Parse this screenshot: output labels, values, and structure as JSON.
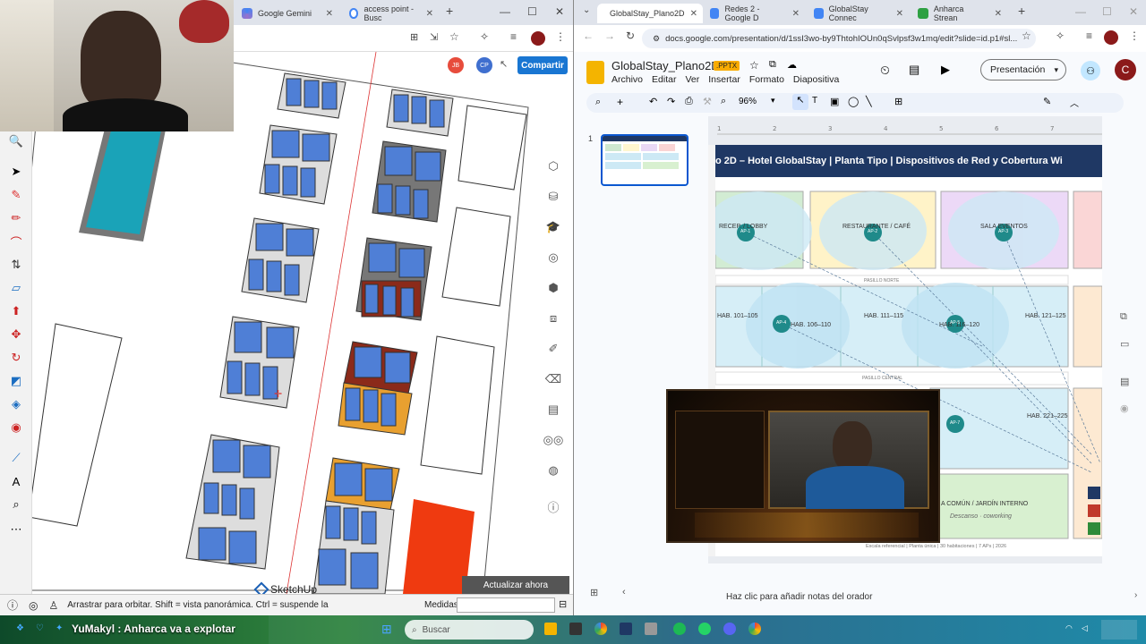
{
  "left_browser": {
    "tabs": [
      {
        "label": "Google Gemini"
      },
      {
        "label": "access point - Busc"
      }
    ],
    "share_button": "Compartir",
    "avatar_a": "JB",
    "avatar_b": "CP"
  },
  "sketchup": {
    "logo": "SketchUp",
    "update_button": "Actualizar ahora",
    "status_text": "Arrastrar para orbitar. Shift = vista panorámica. Ctrl = suspende la",
    "measures_label": "Medidas"
  },
  "right_browser": {
    "tabs": [
      {
        "label": "GlobalStay_Plano2D"
      },
      {
        "label": "Redes 2 - Google D"
      },
      {
        "label": "GlobalStay Connec"
      },
      {
        "label": "Anharca Strean"
      }
    ],
    "url": "docs.google.com/presentation/d/1ssI3wo-by9ThtohIOUn0qSvlpsf3w1mq/edit?slide=id.p1#sl...",
    "avatar": "C"
  },
  "slides": {
    "doc_title": "GlobalStay_Plano2D",
    "doc_badge": ".PPTX",
    "menu": [
      "Archivo",
      "Editar",
      "Ver",
      "Insertar",
      "Formato",
      "Diapositiva"
    ],
    "present_button": "Presentación",
    "zoom": "96%",
    "thumb_number": "1",
    "slide_title": "o 2D – Hotel GlobalStay  |  Planta Tipo  |  Dispositivos de Red y Cobertura Wi",
    "rooms": [
      {
        "label": "RECEP. / LOBBY",
        "ap": "AP-1"
      },
      {
        "label": "RESTAURANTE / CAFÉ",
        "ap": "AP-2"
      },
      {
        "label": "SALA EVENTOS",
        "ap": "AP-3"
      },
      {
        "label": "HAB. 101–105",
        "ap": ""
      },
      {
        "label": "HAB. 106–110",
        "ap": "AP-4"
      },
      {
        "label": "HAB. 111–115",
        "ap": ""
      },
      {
        "label": "HAB. 116–120",
        "ap": "AP-5"
      },
      {
        "label": "HAB. 121–125",
        "ap": ""
      },
      {
        "label": "HAB. 221–225",
        "ap": "AP-7"
      },
      {
        "label": "A COMÚN / JARDÍN INTERNO",
        "ap": ""
      }
    ],
    "pasillo_norte": "PASILLO NORTE",
    "pasillo_central": "PASILLO CENTRAL",
    "descanso": "Descanso · coworking",
    "footer": "Escala referencial  |  Planta única  |  30 habitaciones  |  7 APs  |  2026",
    "notes": "Haz clic para añadir notas del orador"
  },
  "taskbar": {
    "stream_text": "YuMakyl : Anharca va a explotar",
    "search": "Buscar"
  }
}
